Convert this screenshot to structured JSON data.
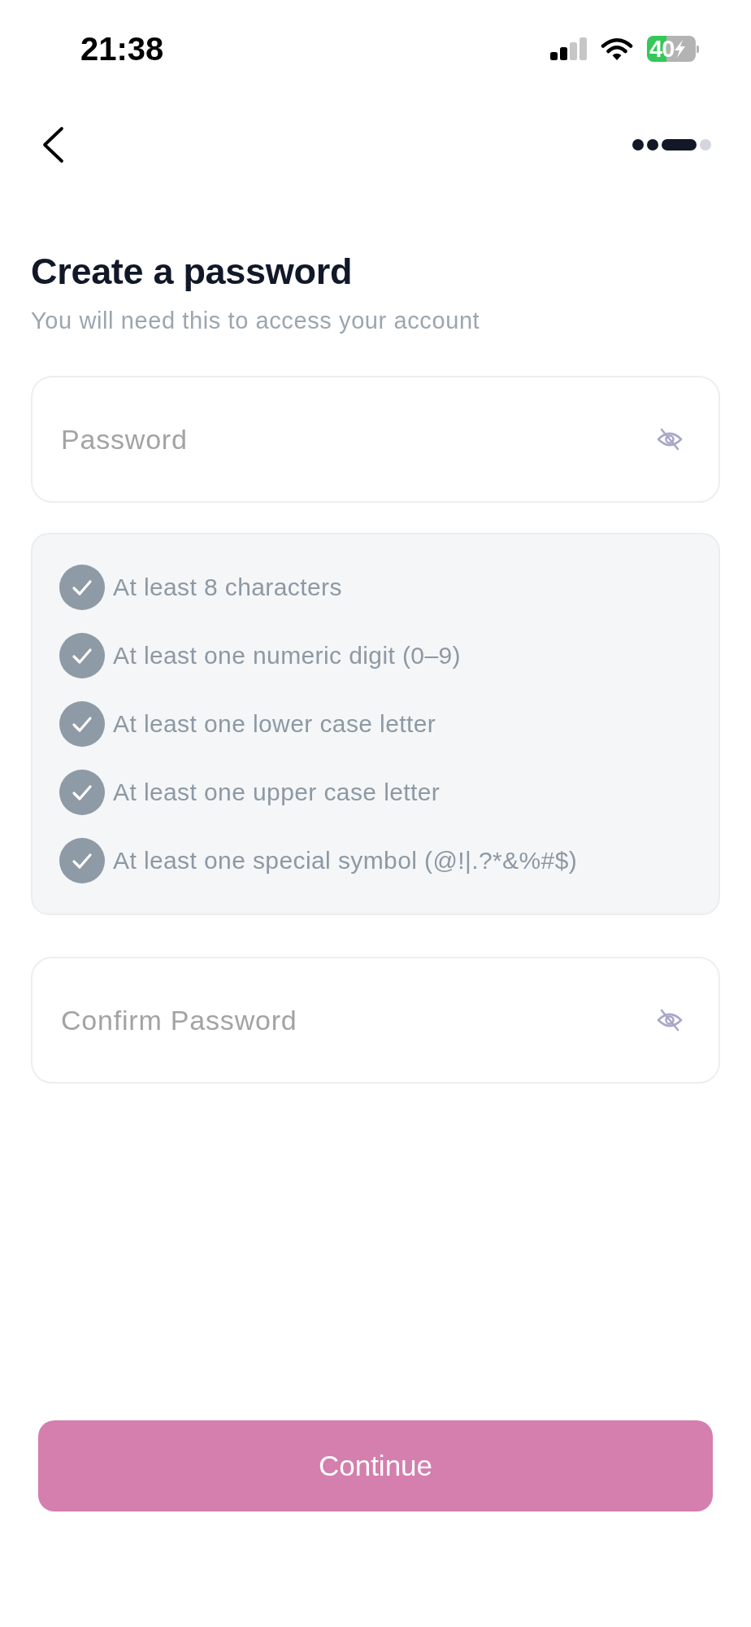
{
  "status_bar": {
    "time": "21:38",
    "battery": "40"
  },
  "header": {
    "steps": [
      {
        "kind": "dot",
        "reached": true
      },
      {
        "kind": "dot",
        "reached": true
      },
      {
        "kind": "pill",
        "reached": true
      },
      {
        "kind": "dot",
        "reached": false
      }
    ]
  },
  "title": "Create a password",
  "subtitle": "You will need this to access your account",
  "password_field": {
    "placeholder": "Password"
  },
  "requirements": [
    {
      "text": "At least 8 characters",
      "checked": true
    },
    {
      "text": "At least one numeric digit (0–9)",
      "checked": true
    },
    {
      "text": "At least one lower case letter",
      "checked": true
    },
    {
      "text": "At least one upper case letter",
      "checked": true
    },
    {
      "text": "At least one special symbol (@!|.?*&%#$)",
      "checked": true
    }
  ],
  "confirm_password_field": {
    "placeholder": "Confirm Password"
  },
  "continue_button": {
    "label": "Continue",
    "disabled": true
  }
}
